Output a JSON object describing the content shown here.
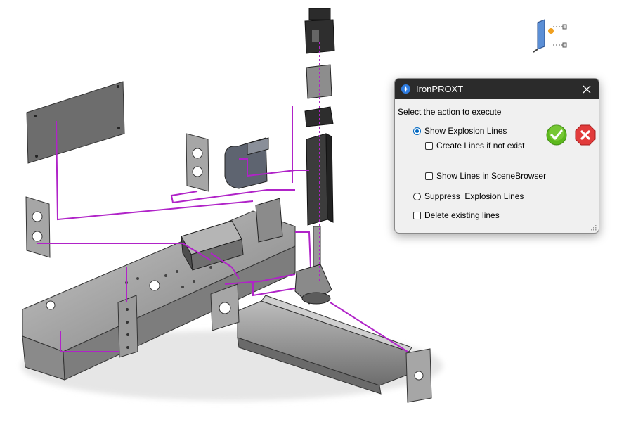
{
  "dialog": {
    "title": "IronPROXT",
    "prompt": "Select the action to execute",
    "options": {
      "show_explosion_lines": {
        "label": "Show Explosion Lines",
        "checked": true
      },
      "create_lines_if_not_exist": {
        "label": "Create Lines if not exist",
        "checked": false
      },
      "show_lines_in_scenebrowser": {
        "label": "Show Lines in SceneBrowser",
        "checked": false
      },
      "suppress_explosion_lines": {
        "label": "Suppress  Explosion Lines",
        "checked": false
      },
      "delete_existing_lines": {
        "label": "Delete existing lines",
        "checked": false
      }
    },
    "ok_icon": "green-checkmark-icon",
    "cancel_icon": "red-x-icon"
  },
  "colors": {
    "explosion_line": "#b023c8",
    "part_metal": "#9b9b9b",
    "titlebar": "#2b2b2b",
    "ok_green": "#5cb81c",
    "cancel_red": "#e23b3b",
    "radio_accent": "#0067c0"
  }
}
